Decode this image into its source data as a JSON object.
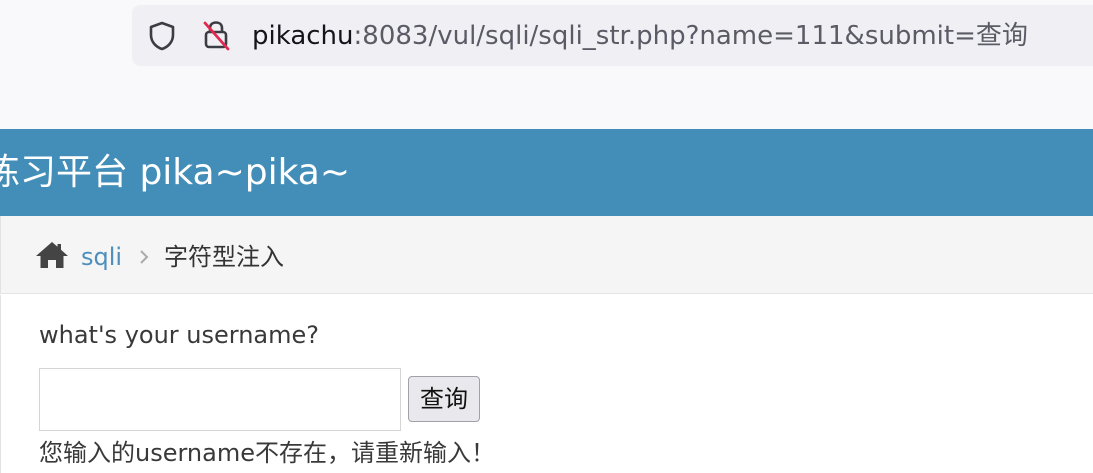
{
  "browser": {
    "url_host": "pikachu",
    "url_rest": ":8083/vul/sqli/sqli_str.php?name=111&submit=查询",
    "icons": [
      "shield-icon",
      "lock-icon"
    ]
  },
  "header": {
    "title": "练习平台 pika~pika~"
  },
  "breadcrumb": {
    "home_icon": "home-icon",
    "link_label": "sqli",
    "current_label": "字符型注入",
    "link_color": "#4c8fbd"
  },
  "form": {
    "question": "what's your username?",
    "input_value": "",
    "submit_label": "查询"
  },
  "result": {
    "message": "您输入的username不存在，请重新输入！"
  },
  "colors": {
    "header_bg": "#438eb9",
    "breadcrumb_bg": "#f5f5f5"
  }
}
